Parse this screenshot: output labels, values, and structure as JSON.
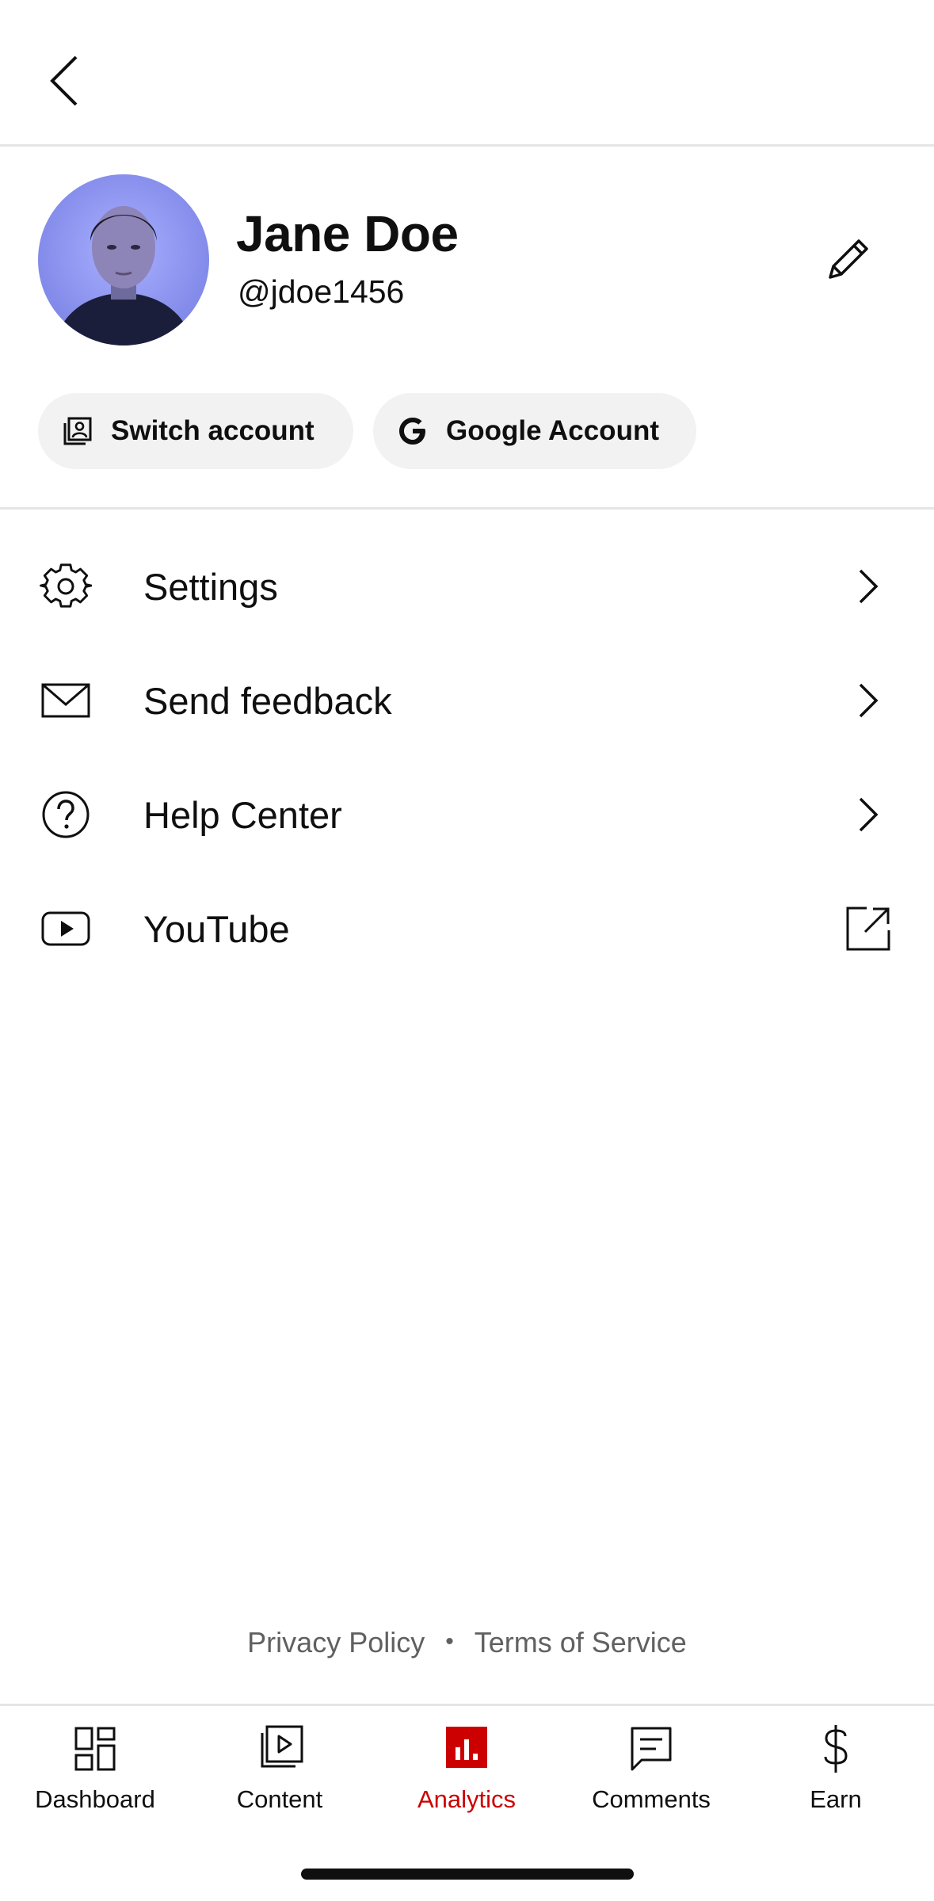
{
  "profile": {
    "name": "Jane Doe",
    "handle": "@jdoe1456"
  },
  "actions": {
    "switch_account": "Switch account",
    "google_account": "Google Account"
  },
  "menu": [
    {
      "label": "Settings",
      "icon": "gear-icon",
      "trailing": "chevron-right-icon"
    },
    {
      "label": "Send feedback",
      "icon": "mail-icon",
      "trailing": "chevron-right-icon"
    },
    {
      "label": "Help Center",
      "icon": "help-icon",
      "trailing": "chevron-right-icon"
    },
    {
      "label": "YouTube",
      "icon": "youtube-play-icon",
      "trailing": "external-link-icon"
    }
  ],
  "footer": {
    "privacy": "Privacy Policy",
    "separator": "•",
    "terms": "Terms of Service"
  },
  "nav": {
    "active": "Analytics",
    "accent_color": "#cc0000",
    "tabs": [
      {
        "label": "Dashboard",
        "icon": "dashboard-icon"
      },
      {
        "label": "Content",
        "icon": "content-icon"
      },
      {
        "label": "Analytics",
        "icon": "analytics-icon"
      },
      {
        "label": "Comments",
        "icon": "comments-icon"
      },
      {
        "label": "Earn",
        "icon": "dollar-icon"
      }
    ]
  }
}
